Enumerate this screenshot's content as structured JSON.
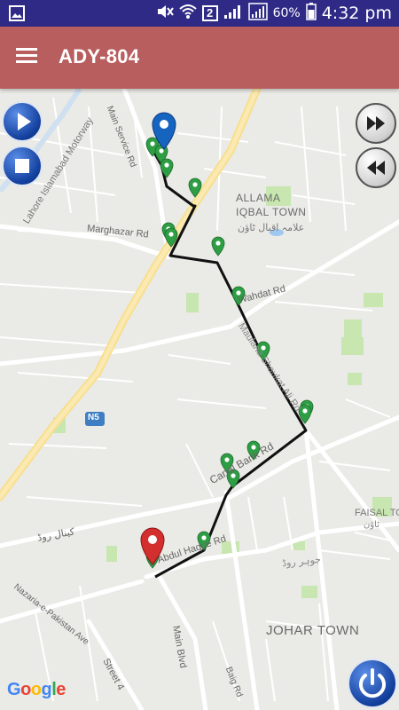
{
  "status_bar": {
    "battery_percent": "60%",
    "time": "4:32 pm",
    "sim_badge": "2",
    "icons": [
      "gallery-icon",
      "mute-icon",
      "wifi-icon",
      "signal-icon",
      "battery-icon"
    ]
  },
  "app_bar": {
    "title": "ADY-804",
    "menu_icon": "hamburger-menu-icon"
  },
  "map": {
    "labels": {
      "motorway": "Lahore Islamabad Motorway",
      "main_service_rd": "Main Service Rd",
      "marghazar_rd": "Marghazar Rd",
      "allama_iqbal_town": "ALLAMA IQBAL TOWN",
      "allama_iqbal_town_urdu": "علامہ اقبال ٹاؤن",
      "wahdat_rd": "Wahdat Rd",
      "maulana_shaukat_ali_rd": "Maulana Shaukat Ali Rd",
      "n5": "N5",
      "canal_bank_rd": "Canal Bank Rd",
      "canal_rd_urdu": "کینال روڈ",
      "faisal_town": "FAISAL TO",
      "faisal_town_urdu": "ٹاؤن",
      "abdul_haque_rd": "Abdul Haque Rd",
      "nazaria_e_pakistan_ave": "Nazaria-e-Pakistan Ave",
      "main_blvd": "Main Blvd",
      "johar_town": "JOHAR TOWN",
      "street_4": "Street 4",
      "baig_rd": "Baig Rd",
      "urdu_road": "جوہر روڈ"
    },
    "attribution": "Google",
    "route_color": "#111111",
    "pin_colors": {
      "start": "#1565c0",
      "end": "#d32f2f",
      "waypoint": "#2e9e44"
    }
  },
  "controls": {
    "play": "play-icon",
    "stop": "stop-icon",
    "fast_forward": "fast-forward-icon",
    "rewind": "rewind-icon",
    "power": "power-icon"
  }
}
